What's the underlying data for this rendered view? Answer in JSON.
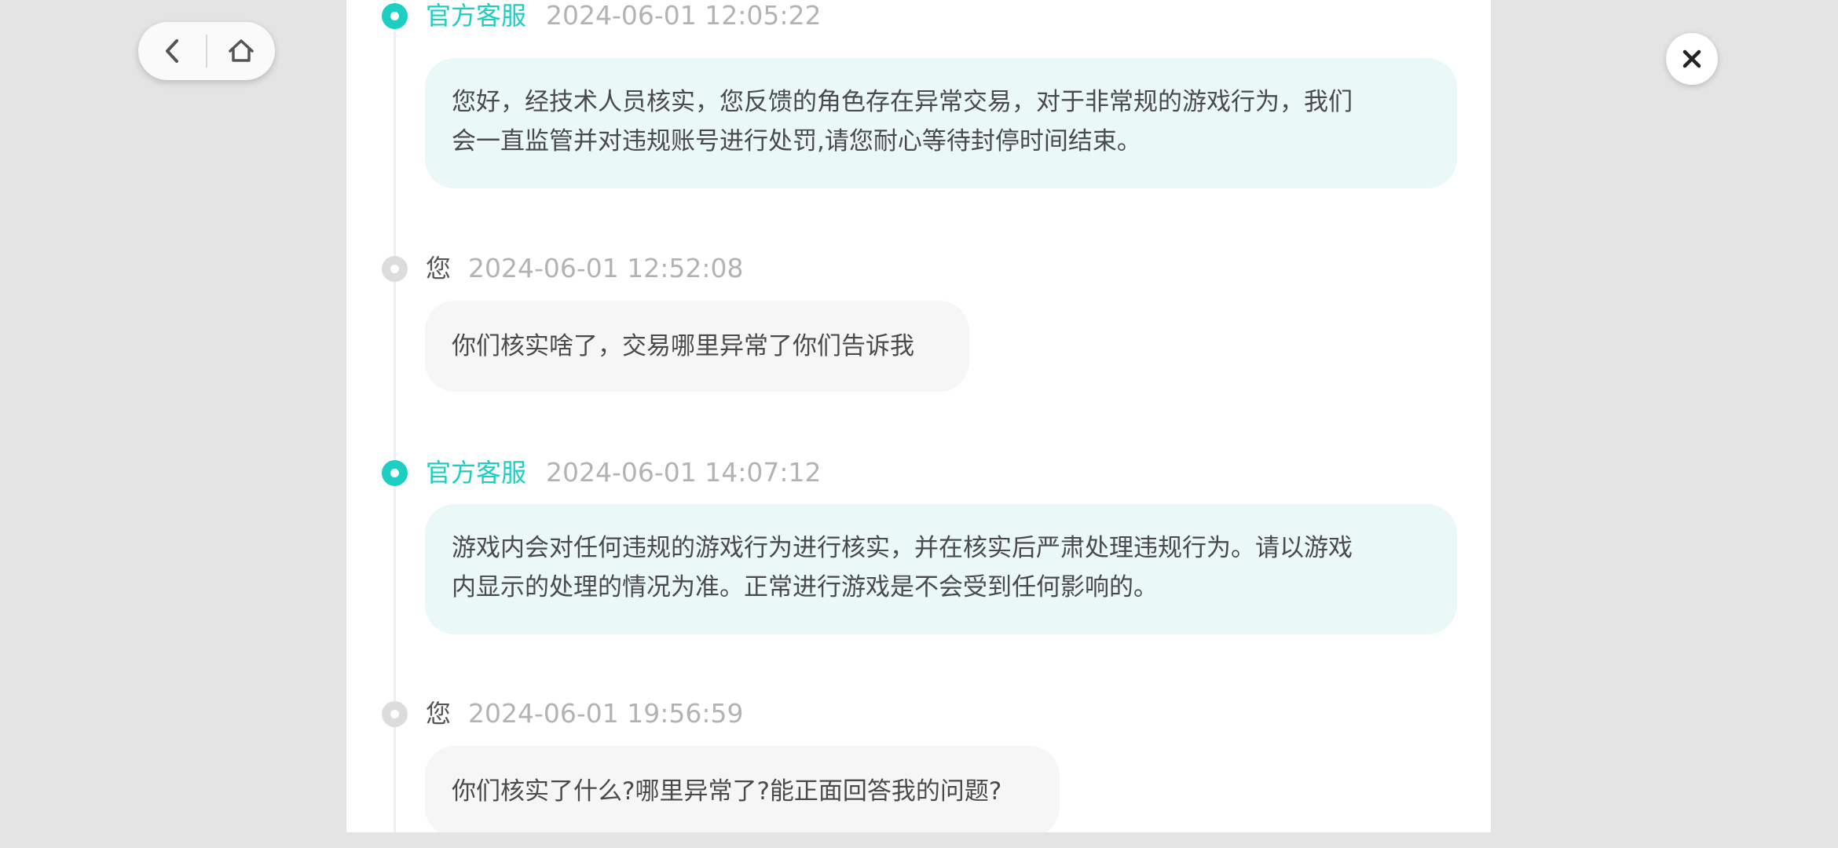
{
  "nav": {
    "back_icon": "chevron-left-icon",
    "home_icon": "home-icon"
  },
  "close_icon": "close-icon",
  "colors": {
    "staff_accent": "#1ccfc2",
    "staff_bubble": "#ebf8f8",
    "user_dot": "#dcdcdc",
    "user_bubble": "#f6f6f6",
    "timestamp": "#b3b3b3",
    "page_background": "#e4e4e4"
  },
  "messages": [
    {
      "role": "staff",
      "sender": "官方客服",
      "time": "2024-06-01 12:05:22",
      "lines": [
        "您好，经技术人员核实，您反馈的角色存在异常交易，对于非常规的游戏行为，我们",
        "会一直监管并对违规账号进行处罚,请您耐心等待封停时间结束。"
      ]
    },
    {
      "role": "user",
      "sender": "您",
      "time": "2024-06-01 12:52:08",
      "lines": [
        "你们核实啥了，交易哪里异常了你们告诉我"
      ]
    },
    {
      "role": "staff",
      "sender": "官方客服",
      "time": "2024-06-01 14:07:12",
      "lines": [
        "游戏内会对任何违规的游戏行为进行核实，并在核实后严肃处理违规行为。请以游戏",
        "内显示的处理的情况为准。正常进行游戏是不会受到任何影响的。"
      ]
    },
    {
      "role": "user",
      "sender": "您",
      "time": "2024-06-01 19:56:59",
      "lines": [
        "你们核实了什么?哪里异常了?能正面回答我的问题?"
      ]
    }
  ]
}
